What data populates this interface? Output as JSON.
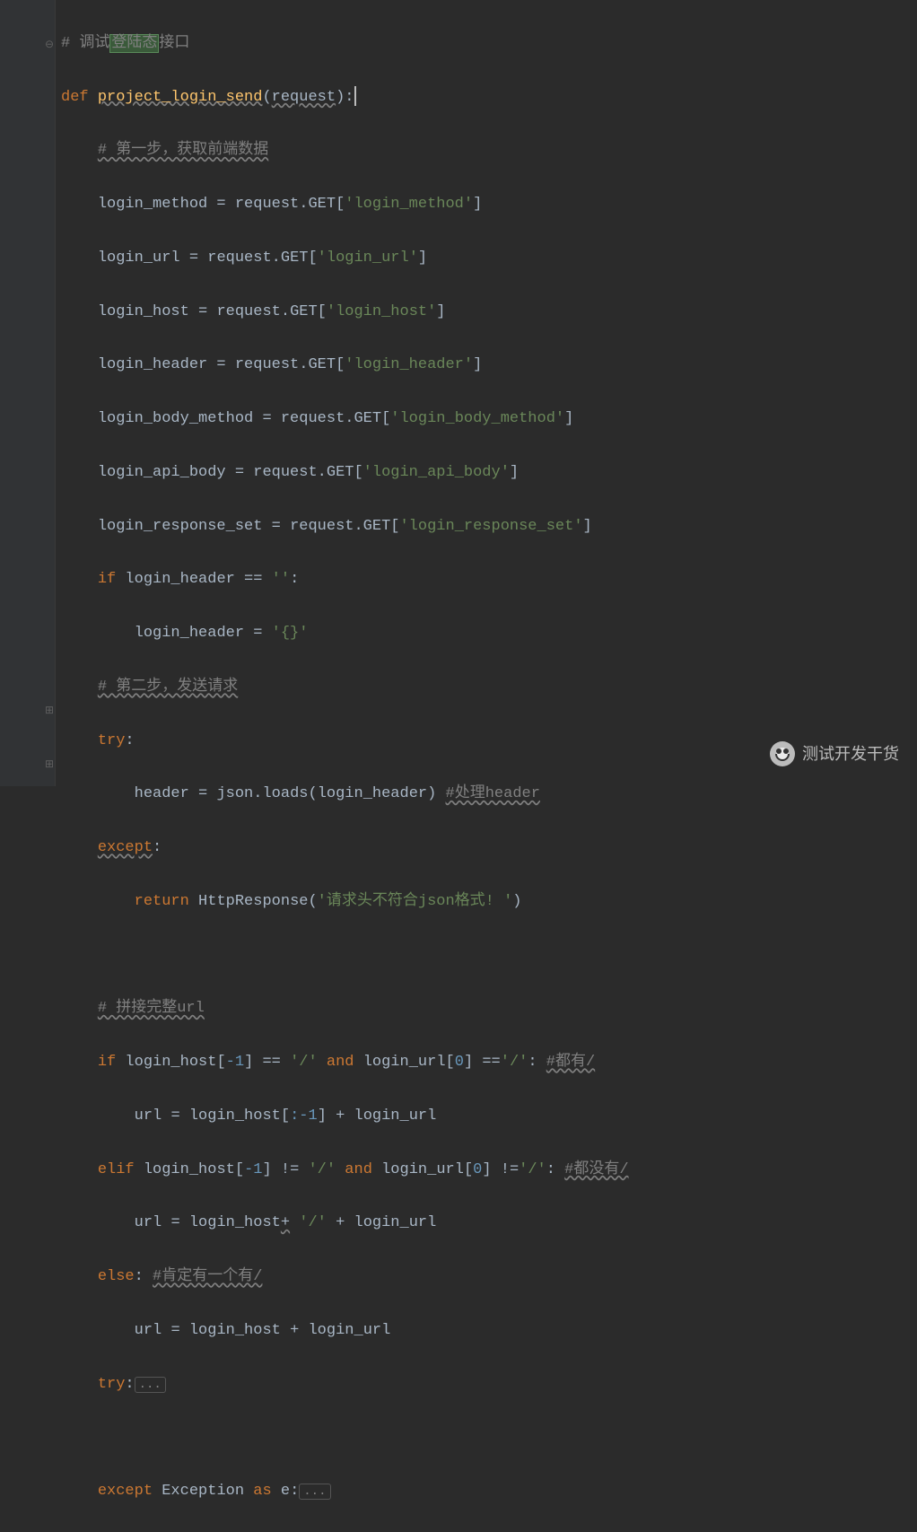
{
  "code": {
    "comment_top": "# 调试登陆态接口",
    "highlight_chars": "登陆态",
    "def_keyword": "def",
    "func_name": "project_login_send",
    "func_param": "request",
    "comment_step1": "# 第一步，获取前端数据",
    "assigns": [
      {
        "var": "login_method",
        "expr": "request.GET",
        "key": "'login_method'"
      },
      {
        "var": "login_url",
        "expr": "request.GET",
        "key": "'login_url'"
      },
      {
        "var": "login_host",
        "expr": "request.GET",
        "key": "'login_host'"
      },
      {
        "var": "login_header",
        "expr": "request.GET",
        "key": "'login_header'"
      },
      {
        "var": "login_body_method",
        "expr": "request.GET",
        "key": "'login_body_method'"
      },
      {
        "var": "login_api_body",
        "expr": "request.GET",
        "key": "'login_api_body'"
      },
      {
        "var": "login_response_set",
        "expr": "request.GET",
        "key": "'login_response_set'"
      }
    ],
    "if_header": {
      "kw_if": "if",
      "var": "login_header",
      "op": "==",
      "val": "''",
      "colon": ":"
    },
    "if_header_body": {
      "var": "login_header",
      "op": "=",
      "val": "'{}'"
    },
    "comment_step2": "# 第二步，发送请求",
    "try_kw": "try",
    "header_line": {
      "var": "header",
      "op": "=",
      "call": "json.loads",
      "arg": "login_header",
      "comment": "#处理header"
    },
    "except_kw": "except",
    "return_line": {
      "kw": "return",
      "call": "HttpResponse",
      "arg": "'请求头不符合json格式! '"
    },
    "comment_url": "# 拼接完整url",
    "if_url1": {
      "kw": "if",
      "lhs": "login_host",
      "idx1": "-1",
      "op1": "==",
      "v1": "'/'",
      "and": "and",
      "rhs": "login_url",
      "idx2": "0",
      "op2": "==",
      "v2": "'/'",
      "c": "#都有/"
    },
    "url_assign1": {
      "var": "url",
      "op": "=",
      "e1": "login_host",
      "slice": ":-1",
      "plus": "+",
      "e2": "login_url"
    },
    "elif_url": {
      "kw": "elif",
      "lhs": "login_host",
      "idx1": "-1",
      "op1": "!=",
      "v1": "'/'",
      "and": "and",
      "rhs": "login_url",
      "idx2": "0",
      "op2": "!=",
      "v2": "'/'",
      "c": "#都没有/"
    },
    "url_assign2": {
      "var": "url",
      "op": "=",
      "e1": "login_host",
      "plus_wavy": "+",
      "v": "'/'",
      "plus2": "+",
      "e2": "login_url"
    },
    "else_kw": "else",
    "else_comment": "#肯定有一个有/",
    "url_assign3": {
      "var": "url",
      "op": "=",
      "e1": "login_host",
      "plus": "+",
      "e2": "login_url"
    },
    "try2_kw": "try",
    "collapsed": "...",
    "except2": {
      "kw": "except",
      "exc": "Exception",
      "as": "as",
      "var": "e"
    }
  },
  "watermark": "测试开发干货",
  "fold_markers": {
    "minus": "⊖",
    "plus": "⊞"
  }
}
